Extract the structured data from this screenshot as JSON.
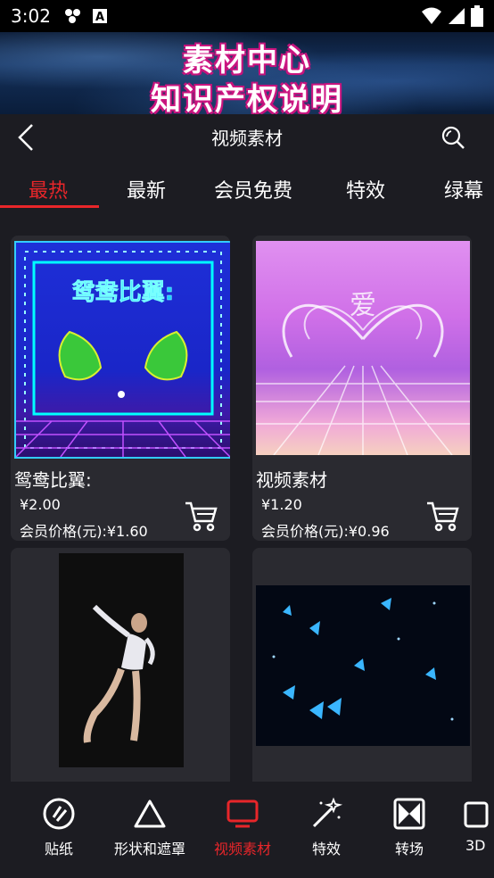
{
  "status": {
    "time": "3:02"
  },
  "banner": {
    "line1": "素材中心",
    "line2": "知识产权说明"
  },
  "nav": {
    "title": "视频素材"
  },
  "tabs": [
    {
      "label": "最热",
      "active": true
    },
    {
      "label": "最新"
    },
    {
      "label": "会员免费"
    },
    {
      "label": "特效"
    },
    {
      "label": "绿幕"
    }
  ],
  "cards": [
    {
      "title": "鸳鸯比翼:",
      "price": "¥2.00",
      "member": "会员价格(元):¥1.60",
      "thumb_text": "鸳鸯比翼:"
    },
    {
      "title": "视频素材",
      "price": "¥1.20",
      "member": "会员价格(元):¥0.96",
      "thumb_text": "爱"
    },
    {
      "title": ""
    },
    {
      "title": ""
    }
  ],
  "bottom_nav": [
    {
      "label": "贴纸",
      "icon": "sticker-icon"
    },
    {
      "label": "形状和遮罩",
      "icon": "triangle-icon"
    },
    {
      "label": "视频素材",
      "icon": "monitor-icon",
      "active": true
    },
    {
      "label": "特效",
      "icon": "magic-wand-icon"
    },
    {
      "label": "转场",
      "icon": "transition-icon"
    },
    {
      "label": "3D",
      "icon": "cube-icon"
    }
  ],
  "colors": {
    "accent": "#e8262a",
    "background": "#1c1c22",
    "card": "#2a2a30"
  }
}
